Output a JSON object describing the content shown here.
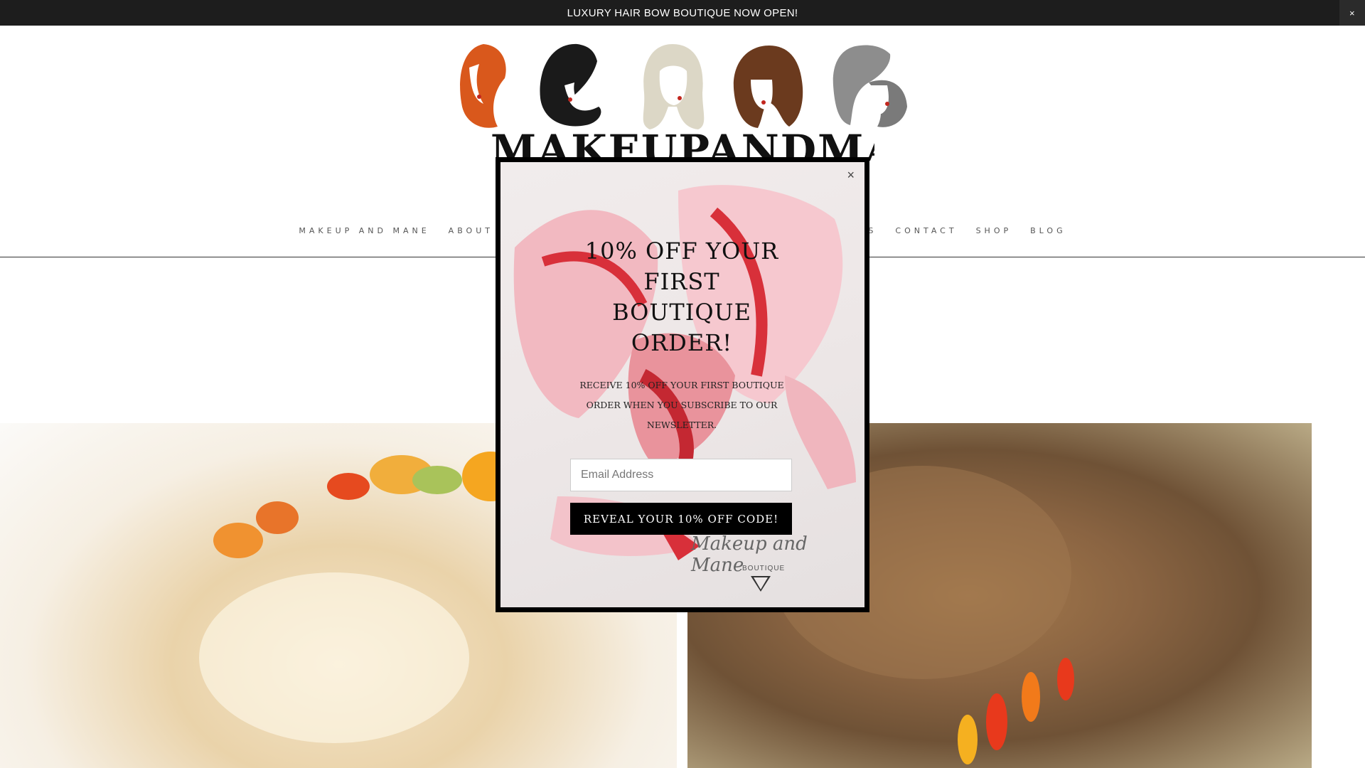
{
  "announcement": {
    "text": "LUXURY HAIR BOW BOUTIQUE NOW OPEN!",
    "close": "×"
  },
  "logo": {
    "text": "MAKEUPANDMANE"
  },
  "nav": {
    "items": [
      "MAKEUP AND MANE",
      "ABOUT",
      "S",
      "",
      "UCTS",
      "CONTACT",
      "SHOP",
      "BLOG"
    ],
    "active_color": "#e8743b"
  },
  "modal": {
    "close": "×",
    "title": "10% OFF YOUR FIRST BOUTIQUE ORDER!",
    "description": "RECEIVE 10% OFF YOUR FIRST BOUTIQUE ORDER WHEN YOU SUBSCRIBE TO OUR NEWSLETTER.",
    "email_placeholder": "Email Address",
    "email_value": "",
    "button": "REVEAL YOUR 10% OFF CODE!",
    "signature_script": "Makeup and Mane",
    "signature_sub": "BOUTIQUE"
  },
  "colors": {
    "announcement_bg": "#1d1d1d",
    "modal_border": "#000000",
    "button_bg": "#000000"
  }
}
